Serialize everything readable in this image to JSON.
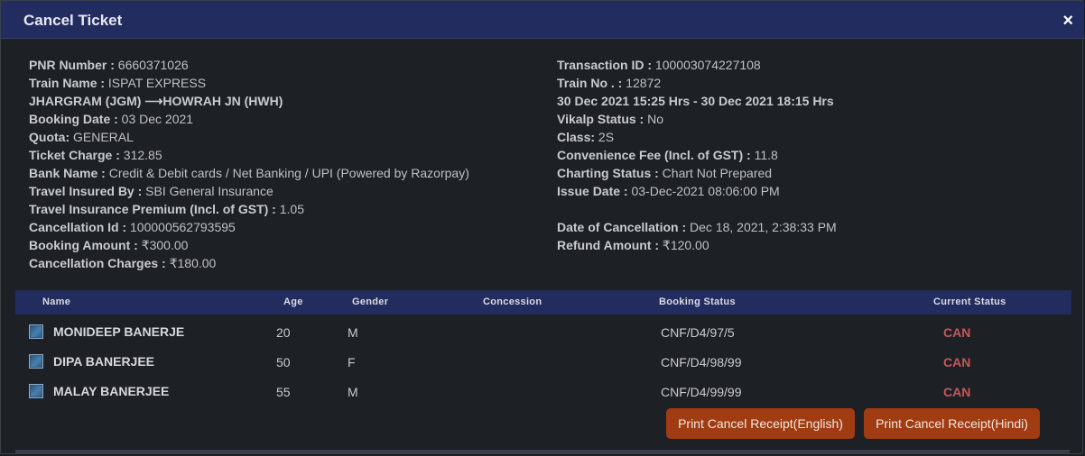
{
  "dialog": {
    "title": "Cancel Ticket",
    "close_glyph": "×"
  },
  "left_info": [
    {
      "label": "PNR Number : ",
      "value": "6660371026"
    },
    {
      "label": "Train Name : ",
      "value": "ISPAT EXPRESS"
    },
    {
      "label": "JHARGRAM (JGM) ",
      "value": "HOWRAH JN (HWH)",
      "arrow": "⟶"
    },
    {
      "label": "Booking Date : ",
      "value": "03 Dec 2021"
    },
    {
      "label": "Quota: ",
      "value": "GENERAL"
    },
    {
      "label": "Ticket Charge : ",
      "value": "312.85"
    },
    {
      "label": "Bank Name : ",
      "value": "Credit & Debit cards / Net Banking / UPI (Powered by Razorpay)"
    },
    {
      "label": "Travel Insured By : ",
      "value": "SBI General Insurance"
    },
    {
      "label": "Travel Insurance Premium (Incl. of GST) : ",
      "value": "1.05"
    },
    {
      "label": "Cancellation Id : ",
      "value": "100000562793595"
    },
    {
      "label": "Booking Amount : ",
      "value": "₹300.00"
    },
    {
      "label": "Cancellation Charges : ",
      "value": "₹180.00"
    }
  ],
  "right_info": [
    {
      "label": "Transaction ID : ",
      "value": "100003074227108"
    },
    {
      "label": "Train No . : ",
      "value": "12872"
    },
    {
      "label": "30 Dec 2021 15:25 Hrs - 30 Dec 2021 18:15 Hrs",
      "value": ""
    },
    {
      "label": "Vikalp Status : ",
      "value": "No"
    },
    {
      "label": "Class: ",
      "value": "2S"
    },
    {
      "label": "Convenience Fee (Incl. of GST) : ",
      "value": "11.8"
    },
    {
      "label": "Charting Status : ",
      "value": "Chart Not Prepared"
    },
    {
      "label": "Issue Date : ",
      "value": "03-Dec-2021 08:06:00 PM"
    },
    {
      "label": "",
      "value": ""
    },
    {
      "label": "Date of Cancellation : ",
      "value": "Dec 18, 2021, 2:38:33 PM"
    },
    {
      "label": "Refund Amount : ",
      "value": "₹120.00"
    }
  ],
  "table": {
    "headers": {
      "name": "Name",
      "age": "Age",
      "gender": "Gender",
      "concession": "Concession",
      "booking_status": "Booking Status",
      "current_status": "Current Status"
    },
    "rows": [
      {
        "name": "MONIDEEP BANERJE",
        "age": "20",
        "gender": "M",
        "concession": "",
        "booking_status": "CNF/D4/97/5",
        "current_status": "CAN"
      },
      {
        "name": "DIPA BANERJEE",
        "age": "50",
        "gender": "F",
        "concession": "",
        "booking_status": "CNF/D4/98/99",
        "current_status": "CAN"
      },
      {
        "name": "MALAY BANERJEE",
        "age": "55",
        "gender": "M",
        "concession": "",
        "booking_status": "CNF/D4/99/99",
        "current_status": "CAN"
      }
    ]
  },
  "buttons": {
    "print_english": "Print Cancel Receipt(English)",
    "print_hindi": "Print Cancel Receipt(Hindi)"
  },
  "colors": {
    "header_bg": "#232c5f",
    "body_bg": "#1d2025",
    "status_can": "#c2595a",
    "button_bg": "#a13c12"
  }
}
